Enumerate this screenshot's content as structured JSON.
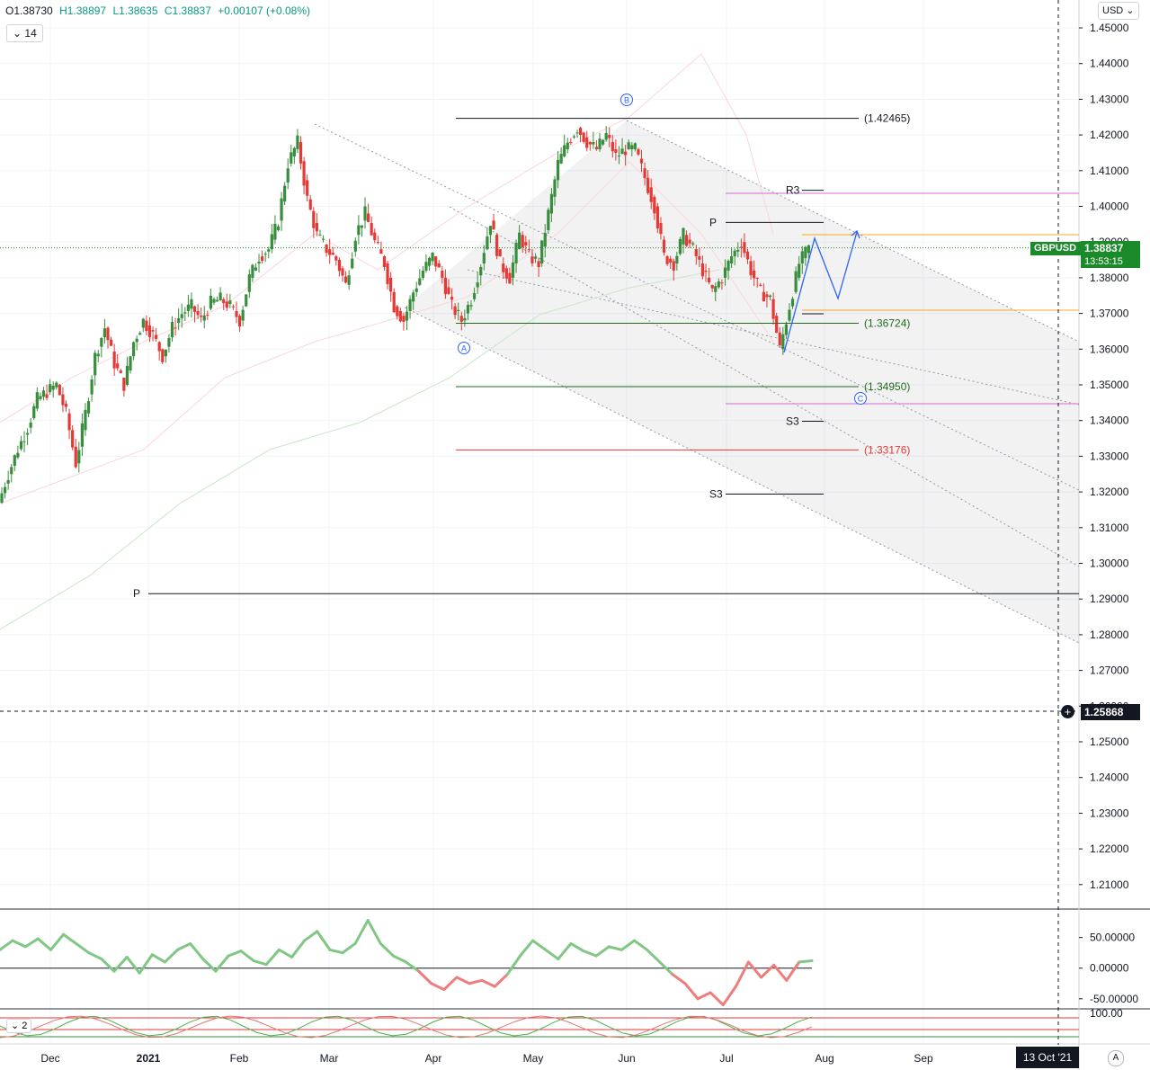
{
  "header": {
    "ohlc": {
      "open": "O1.38730",
      "high": "H1.38897",
      "low": "L1.38635",
      "close": "C1.38837",
      "change": "+0.00107 (+0.08%)"
    },
    "interval_value": "14",
    "currency": "USD",
    "symbol": "GBPUSD",
    "last_price": "1.38837",
    "countdown": "13:53:15",
    "crosshair_price": "1.25868",
    "crosshair_date": "13 Oct '21",
    "subpane_label": "2",
    "auto_scale": "A",
    "colors": {
      "up": "#388e3c",
      "down": "#e53935",
      "price_badge": "#1b8a2b",
      "pivot_purple": "#d36bd8",
      "orange": "#f5a623",
      "green_level": "#1e6b1e",
      "red_level": "#e53935",
      "arrow_blue": "#2962ff"
    }
  },
  "chart_data": {
    "type": "candlestick",
    "symbol": "GBPUSD",
    "y_ticks": [
      1.45,
      1.44,
      1.43,
      1.42,
      1.41,
      1.4,
      1.39,
      1.38,
      1.37,
      1.36,
      1.35,
      1.34,
      1.33,
      1.32,
      1.31,
      1.3,
      1.29,
      1.28,
      1.27,
      1.26,
      1.25,
      1.24,
      1.23,
      1.22,
      1.21
    ],
    "y_tick_labels": [
      "1.45000",
      "1.44000",
      "1.43000",
      "1.42000",
      "1.41000",
      "1.40000",
      "1.39000",
      "1.38000",
      "1.37000",
      "1.36000",
      "1.35000",
      "1.34000",
      "1.33000",
      "1.32000",
      "1.31000",
      "1.30000",
      "1.29000",
      "1.28000",
      "1.27000",
      "1.26000",
      "1.25000",
      "1.24000",
      "1.23000",
      "1.22000",
      "1.21000"
    ],
    "ylim": [
      1.2,
      1.4525
    ],
    "x_labels": [
      "Dec",
      "2021",
      "Feb",
      "Mar",
      "Apr",
      "May",
      "Jun",
      "Jul",
      "Aug",
      "Sep"
    ],
    "price_path": [
      1.317,
      1.325,
      1.332,
      1.338,
      1.346,
      1.348,
      1.35,
      1.342,
      1.328,
      1.342,
      1.358,
      1.366,
      1.356,
      1.35,
      1.362,
      1.368,
      1.364,
      1.358,
      1.366,
      1.37,
      1.372,
      1.368,
      1.373,
      1.374,
      1.372,
      1.368,
      1.38,
      1.386,
      1.388,
      1.396,
      1.412,
      1.418,
      1.402,
      1.392,
      1.388,
      1.385,
      1.378,
      1.392,
      1.398,
      1.39,
      1.384,
      1.372,
      1.368,
      1.376,
      1.382,
      1.386,
      1.38,
      1.372,
      1.368,
      1.374,
      1.384,
      1.396,
      1.384,
      1.38,
      1.392,
      1.386,
      1.384,
      1.398,
      1.412,
      1.418,
      1.422,
      1.418,
      1.416,
      1.42,
      1.414,
      1.416,
      1.416,
      1.408,
      1.4,
      1.386,
      1.384,
      1.392,
      1.388,
      1.382,
      1.376,
      1.38,
      1.386,
      1.39,
      1.382,
      1.376,
      1.374,
      1.36,
      1.372,
      1.384,
      1.3884
    ],
    "levels": [
      {
        "label": "(1.42465)",
        "value": 1.42465,
        "color": "#131722"
      },
      {
        "label": "(1.36724)",
        "value": 1.36724,
        "color": "#1e6b1e"
      },
      {
        "label": "(1.34950)",
        "value": 1.3495,
        "color": "#1e6b1e"
      },
      {
        "label": "(1.33176)",
        "value": 1.33176,
        "color": "#e53935"
      }
    ],
    "pivots": [
      {
        "label": "R3",
        "value": 1.4045
      },
      {
        "label": "P",
        "value": 1.3955
      },
      {
        "label": "S3",
        "value": 1.3398
      },
      {
        "label": "S3",
        "value": 1.3194
      },
      {
        "label": "P",
        "value": 1.2915
      }
    ],
    "wave_labels": [
      "A",
      "B",
      "C"
    ],
    "oscillator": {
      "y_tick_labels": [
        "50.00000",
        "0.00000",
        "-50.00000"
      ],
      "y_ticks": [
        50,
        0,
        -50
      ],
      "values": [
        30,
        45,
        35,
        48,
        30,
        55,
        40,
        25,
        15,
        -5,
        18,
        -8,
        22,
        10,
        30,
        40,
        15,
        -5,
        20,
        28,
        12,
        6,
        30,
        18,
        45,
        60,
        30,
        25,
        40,
        78,
        40,
        20,
        10,
        -5,
        -25,
        -35,
        -15,
        -25,
        -20,
        -30,
        -10,
        20,
        45,
        30,
        15,
        40,
        28,
        20,
        35,
        30,
        45,
        30,
        10,
        -10,
        -25,
        -50,
        -40,
        -60,
        -30,
        10,
        -15,
        5,
        -20,
        10,
        12
      ],
      "ylim": [
        -65,
        95
      ]
    },
    "sub2": {
      "y_tick_labels": [
        "100.00"
      ]
    }
  }
}
